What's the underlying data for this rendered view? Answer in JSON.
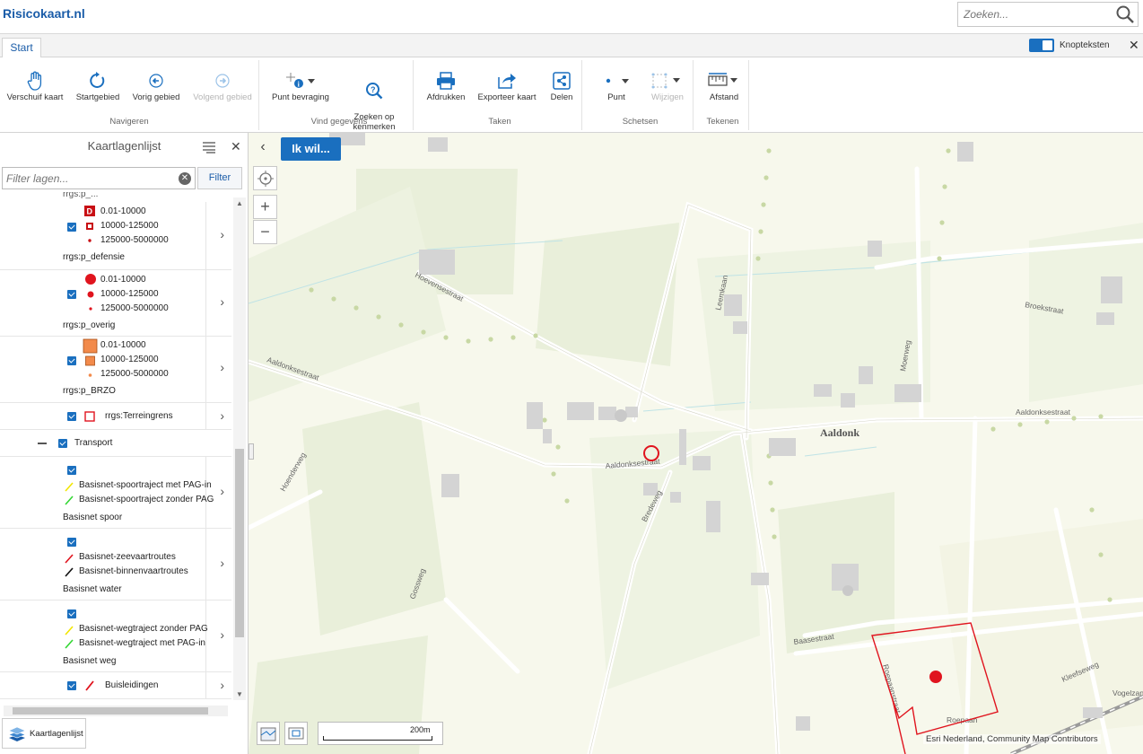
{
  "app": {
    "title": "Risicokaart.nl"
  },
  "search": {
    "placeholder": "Zoeken..."
  },
  "ribbon": {
    "tab": "Start",
    "toggle_label": "Knopteksten",
    "groups": {
      "navigeren": {
        "label": "Navigeren",
        "buttons": [
          "Verschuif kaart",
          "Startgebied",
          "Vorig gebied",
          "Volgend gebied"
        ]
      },
      "vind_gegevens": {
        "label": "Vind gegevens",
        "buttons": [
          "Punt bevraging",
          "Zoeken op\nkenmerken"
        ]
      },
      "taken": {
        "label": "Taken",
        "buttons": [
          "Afdrukken",
          "Exporteer kaart",
          "Delen"
        ]
      },
      "schetsen": {
        "label": "Schetsen",
        "buttons": [
          "Punt",
          "Wijzigen"
        ]
      },
      "tekenen": {
        "label": "Tekenen",
        "buttons": [
          "Afstand"
        ]
      }
    }
  },
  "layers_panel": {
    "title": "Kaartlagenlijst",
    "filter_placeholder": "Filter lagen...",
    "filter_button": "Filter",
    "tab_label": "Kaartlagenlijst",
    "top_fragment": "rrgs:p_...",
    "items": [
      {
        "legend": [
          "0.01-10000",
          "10000-125000",
          "125000-5000000"
        ],
        "name": "rrgs:p_defensie"
      },
      {
        "legend": [
          "0.01-10000",
          "10000-125000",
          "125000-5000000"
        ],
        "name": "rrgs:p_overig"
      },
      {
        "legend": [
          "0.01-10000",
          "10000-125000",
          "125000-5000000"
        ],
        "name": "rrgs:p_BRZO"
      },
      {
        "name": "rrgs:Terreingrens"
      }
    ],
    "group": {
      "name": "Transport"
    },
    "transport_items": [
      {
        "legend": [
          "Basisnet-spoortraject met PAG-in",
          "Basisnet-spoortraject zonder PAG"
        ],
        "name": "Basisnet spoor"
      },
      {
        "legend": [
          "Basisnet-zeevaartroutes",
          "Basisnet-binnenvaartroutes"
        ],
        "name": "Basisnet water"
      },
      {
        "legend": [
          "Basisnet-wegtraject zonder PAG",
          "Basisnet-wegtraject met PAG-in"
        ],
        "name": "Basisnet weg"
      },
      {
        "name": "Buisleidingen"
      }
    ]
  },
  "map": {
    "ik_wil": "Ik wil...",
    "scale_label": "200m",
    "attribution": "Esri Nederland, Community Map Contributors",
    "place_label": "Aaldonk",
    "street_labels": [
      "Hoevensestraat",
      "Aaldonksestraat",
      "Aaldonksestraat",
      "Leemkaan",
      "Moerweg",
      "Broekstraat",
      "Aaldonksestraat",
      "Bredeweg",
      "Hoenderweg",
      "Gossweg",
      "Baasestraat",
      "Kleefseweg",
      "Vogelzang",
      "Roepaan",
      "Roepaanstraat"
    ]
  },
  "colors": {
    "accent": "#1a6fbf",
    "brand": "#1a5ca8",
    "risk_red": "#e0141e"
  }
}
